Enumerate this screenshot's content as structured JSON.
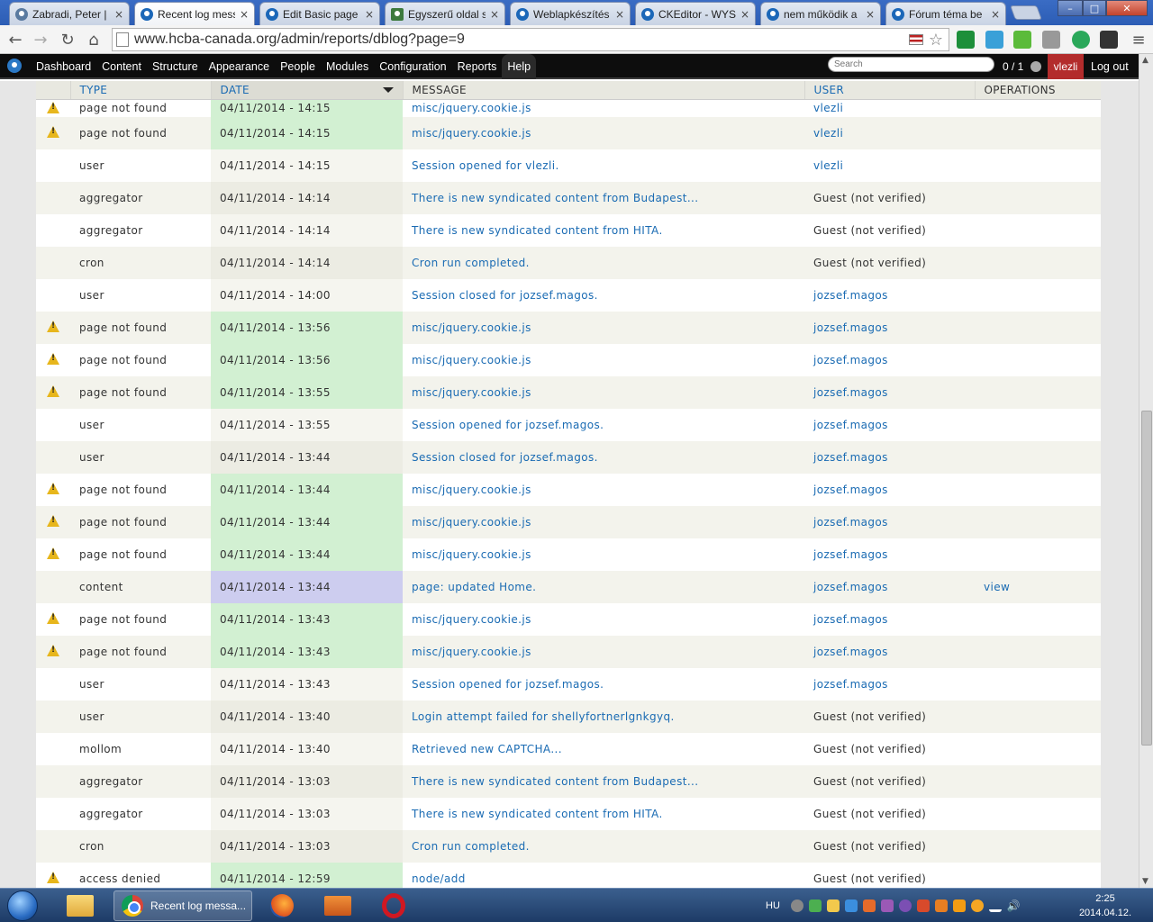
{
  "browser": {
    "tabs": [
      {
        "label": "Zabradi, Peter | ",
        "icon": "person"
      },
      {
        "label": "Recent log mess",
        "icon": "drupal",
        "active": true
      },
      {
        "label": "Edit Basic page ",
        "icon": "drupal"
      },
      {
        "label": "Egyszerű oldal s",
        "icon": "tool"
      },
      {
        "label": "Weblapkészítés",
        "icon": "drupal"
      },
      {
        "label": "CKEditor - WYSI",
        "icon": "drupal"
      },
      {
        "label": "nem működik a",
        "icon": "drupal"
      },
      {
        "label": "Fórum téma be",
        "icon": "drupal"
      }
    ],
    "close_glyph": "×",
    "address": "www.hcba-canada.org/admin/reports/dblog?page=9",
    "nav": {
      "back": "←",
      "forward": "→",
      "reload": "↻",
      "home": "⌂",
      "menu": "≡"
    },
    "window_controls": {
      "minimize": "–",
      "maximize": "□",
      "close": "✕"
    }
  },
  "admin_toolbar": {
    "items": [
      "Dashboard",
      "Content",
      "Structure",
      "Appearance",
      "People",
      "Modules",
      "Configuration",
      "Reports",
      "Help"
    ],
    "active": "Help",
    "search_placeholder": "Search",
    "user_count": "0 / 1",
    "username": "vlezli",
    "logout": "Log out"
  },
  "table": {
    "headers": {
      "type": "TYPE",
      "date": "DATE",
      "message": "MESSAGE",
      "user": "USER",
      "operations": "OPERATIONS"
    },
    "rows": [
      {
        "sev": "warning",
        "type": "page not found",
        "date": "04/11/2014 - 14:15",
        "message": "misc/jquery.cookie.js",
        "user": "vlezli",
        "user_link": true,
        "op": ""
      },
      {
        "sev": "warning",
        "type": "page not found",
        "date": "04/11/2014 - 14:15",
        "message": "misc/jquery.cookie.js",
        "user": "vlezli",
        "user_link": true,
        "op": ""
      },
      {
        "sev": "",
        "type": "user",
        "date": "04/11/2014 - 14:15",
        "message": "Session opened for vlezli.",
        "user": "vlezli",
        "user_link": true,
        "op": ""
      },
      {
        "sev": "",
        "type": "aggregator",
        "date": "04/11/2014 - 14:14",
        "message": "There is new syndicated content from Budapest...",
        "user": "Guest (not verified)",
        "user_link": false,
        "op": ""
      },
      {
        "sev": "",
        "type": "aggregator",
        "date": "04/11/2014 - 14:14",
        "message": "There is new syndicated content from HITA.",
        "user": "Guest (not verified)",
        "user_link": false,
        "op": ""
      },
      {
        "sev": "",
        "type": "cron",
        "date": "04/11/2014 - 14:14",
        "message": "Cron run completed.",
        "user": "Guest (not verified)",
        "user_link": false,
        "op": ""
      },
      {
        "sev": "",
        "type": "user",
        "date": "04/11/2014 - 14:00",
        "message": "Session closed for jozsef.magos.",
        "user": "jozsef.magos",
        "user_link": true,
        "op": ""
      },
      {
        "sev": "warning",
        "type": "page not found",
        "date": "04/11/2014 - 13:56",
        "message": "misc/jquery.cookie.js",
        "user": "jozsef.magos",
        "user_link": true,
        "op": ""
      },
      {
        "sev": "warning",
        "type": "page not found",
        "date": "04/11/2014 - 13:56",
        "message": "misc/jquery.cookie.js",
        "user": "jozsef.magos",
        "user_link": true,
        "op": ""
      },
      {
        "sev": "warning",
        "type": "page not found",
        "date": "04/11/2014 - 13:55",
        "message": "misc/jquery.cookie.js",
        "user": "jozsef.magos",
        "user_link": true,
        "op": ""
      },
      {
        "sev": "",
        "type": "user",
        "date": "04/11/2014 - 13:55",
        "message": "Session opened for jozsef.magos.",
        "user": "jozsef.magos",
        "user_link": true,
        "op": ""
      },
      {
        "sev": "",
        "type": "user",
        "date": "04/11/2014 - 13:44",
        "message": "Session closed for jozsef.magos.",
        "user": "jozsef.magos",
        "user_link": true,
        "op": ""
      },
      {
        "sev": "warning",
        "type": "page not found",
        "date": "04/11/2014 - 13:44",
        "message": "misc/jquery.cookie.js",
        "user": "jozsef.magos",
        "user_link": true,
        "op": ""
      },
      {
        "sev": "warning",
        "type": "page not found",
        "date": "04/11/2014 - 13:44",
        "message": "misc/jquery.cookie.js",
        "user": "jozsef.magos",
        "user_link": true,
        "op": ""
      },
      {
        "sev": "warning",
        "type": "page not found",
        "date": "04/11/2014 - 13:44",
        "message": "misc/jquery.cookie.js",
        "user": "jozsef.magos",
        "user_link": true,
        "op": ""
      },
      {
        "sev": "notice",
        "type": "content",
        "date": "04/11/2014 - 13:44",
        "message": "page: updated Home.",
        "user": "jozsef.magos",
        "user_link": true,
        "op": "view"
      },
      {
        "sev": "warning",
        "type": "page not found",
        "date": "04/11/2014 - 13:43",
        "message": "misc/jquery.cookie.js",
        "user": "jozsef.magos",
        "user_link": true,
        "op": ""
      },
      {
        "sev": "warning",
        "type": "page not found",
        "date": "04/11/2014 - 13:43",
        "message": "misc/jquery.cookie.js",
        "user": "jozsef.magos",
        "user_link": true,
        "op": ""
      },
      {
        "sev": "",
        "type": "user",
        "date": "04/11/2014 - 13:43",
        "message": "Session opened for jozsef.magos.",
        "user": "jozsef.magos",
        "user_link": true,
        "op": ""
      },
      {
        "sev": "",
        "type": "user",
        "date": "04/11/2014 - 13:40",
        "message": "Login attempt failed for shellyfortnerlgnkgyq.",
        "user": "Guest (not verified)",
        "user_link": false,
        "op": ""
      },
      {
        "sev": "",
        "type": "mollom",
        "date": "04/11/2014 - 13:40",
        "message": "Retrieved new CAPTCHA...",
        "user": "Guest (not verified)",
        "user_link": false,
        "op": ""
      },
      {
        "sev": "",
        "type": "aggregator",
        "date": "04/11/2014 - 13:03",
        "message": "There is new syndicated content from Budapest...",
        "user": "Guest (not verified)",
        "user_link": false,
        "op": ""
      },
      {
        "sev": "",
        "type": "aggregator",
        "date": "04/11/2014 - 13:03",
        "message": "There is new syndicated content from HITA.",
        "user": "Guest (not verified)",
        "user_link": false,
        "op": ""
      },
      {
        "sev": "",
        "type": "cron",
        "date": "04/11/2014 - 13:03",
        "message": "Cron run completed.",
        "user": "Guest (not verified)",
        "user_link": false,
        "op": ""
      },
      {
        "sev": "warning",
        "type": "access denied",
        "date": "04/11/2014 - 12:59",
        "message": "node/add",
        "user": "Guest (not verified)",
        "user_link": false,
        "op": ""
      }
    ]
  },
  "taskbar": {
    "chrome_label": "Recent log messa...",
    "language": "HU",
    "time": "2:25",
    "date": "2014.04.12."
  },
  "colors": {
    "link": "#1a6bb3",
    "warning_row_date": "#d2f0d2",
    "notice_row_date": "#cdcdef",
    "admin_user_badge": "#b32c2c"
  }
}
